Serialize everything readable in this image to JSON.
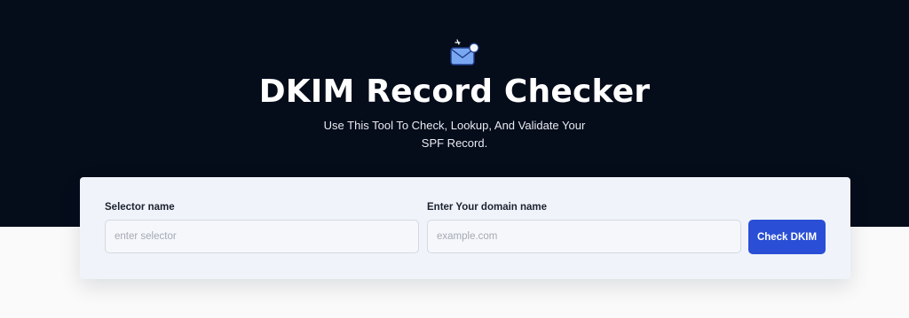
{
  "hero": {
    "icon": "mail-check-icon",
    "title": "DKIM Record Checker",
    "subtitle": "Use This Tool To Check, Lookup, And Validate Your SPF Record."
  },
  "form": {
    "selector": {
      "label": "Selector name",
      "placeholder": "enter selector",
      "value": ""
    },
    "domain": {
      "label": "Enter Your domain name",
      "placeholder": "example.com",
      "value": ""
    },
    "submit_label": "Check DKIM"
  },
  "colors": {
    "hero_background": "#050c1a",
    "card_background": "#f0f4fa",
    "button_background": "#2a4fd6",
    "page_background": "#fafafa"
  }
}
